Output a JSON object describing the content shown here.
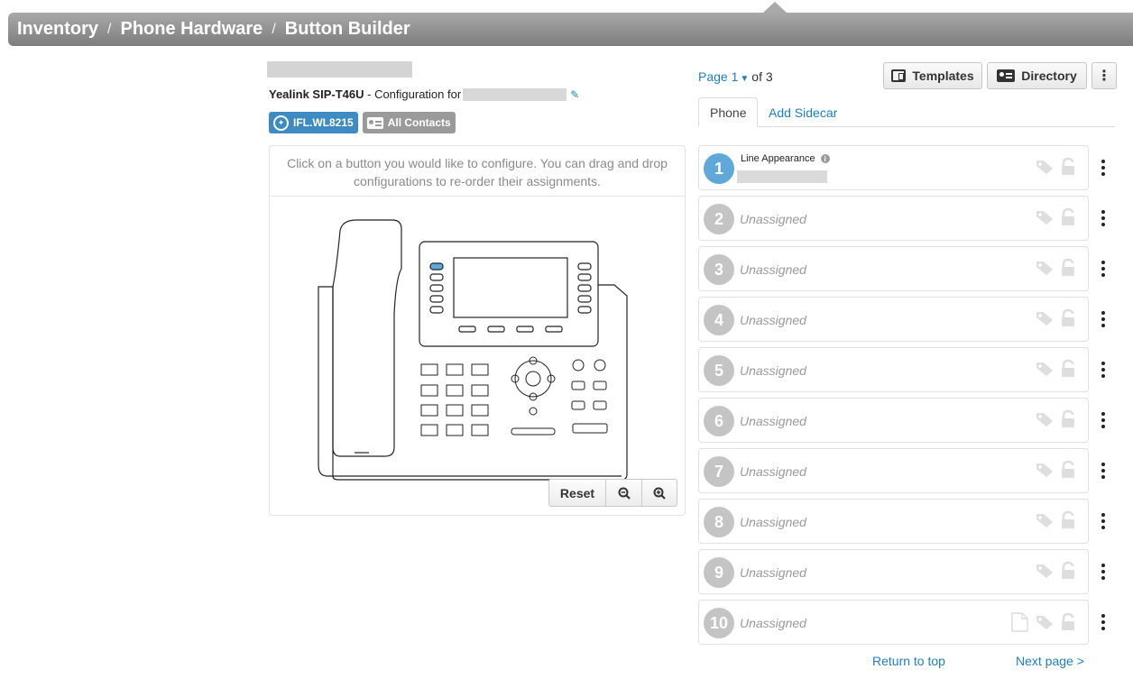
{
  "breadcrumb": [
    "Inventory",
    "Phone Hardware",
    "Button Builder"
  ],
  "breadcrumb_sep": "/",
  "device": {
    "model": "Yealink SIP-T46U",
    "config_text": "- Configuration for"
  },
  "badges": {
    "device_label": "IFL.WL8215",
    "contacts_label": "All Contacts"
  },
  "panel": {
    "hint": "Click on a button you would like to configure. You can drag and drop configurations to re-order their assignments.",
    "reset_label": "Reset"
  },
  "pager": {
    "prefix": "Page",
    "current": "1",
    "suffix": "of 3"
  },
  "toolbar": {
    "templates_label": "Templates",
    "directory_label": "Directory"
  },
  "tabs": {
    "phone": "Phone",
    "sidecar": "Add Sidecar"
  },
  "buttons": [
    {
      "number": "1",
      "title": "Line Appearance",
      "label": ""
    },
    {
      "number": "2",
      "label": "Unassigned"
    },
    {
      "number": "3",
      "label": "Unassigned"
    },
    {
      "number": "4",
      "label": "Unassigned"
    },
    {
      "number": "5",
      "label": "Unassigned"
    },
    {
      "number": "6",
      "label": "Unassigned"
    },
    {
      "number": "7",
      "label": "Unassigned"
    },
    {
      "number": "8",
      "label": "Unassigned"
    },
    {
      "number": "9",
      "label": "Unassigned"
    },
    {
      "number": "10",
      "label": "Unassigned"
    }
  ],
  "footer": {
    "return_top": "Return to top",
    "next_page": "Next page >"
  },
  "colors": {
    "accent": "#1d7fc4",
    "active_button": "#5fa8d9",
    "inactive_button": "#c4c4c4",
    "badge_blue": "#3e8ac2",
    "badge_gray": "#9a9a9a"
  }
}
